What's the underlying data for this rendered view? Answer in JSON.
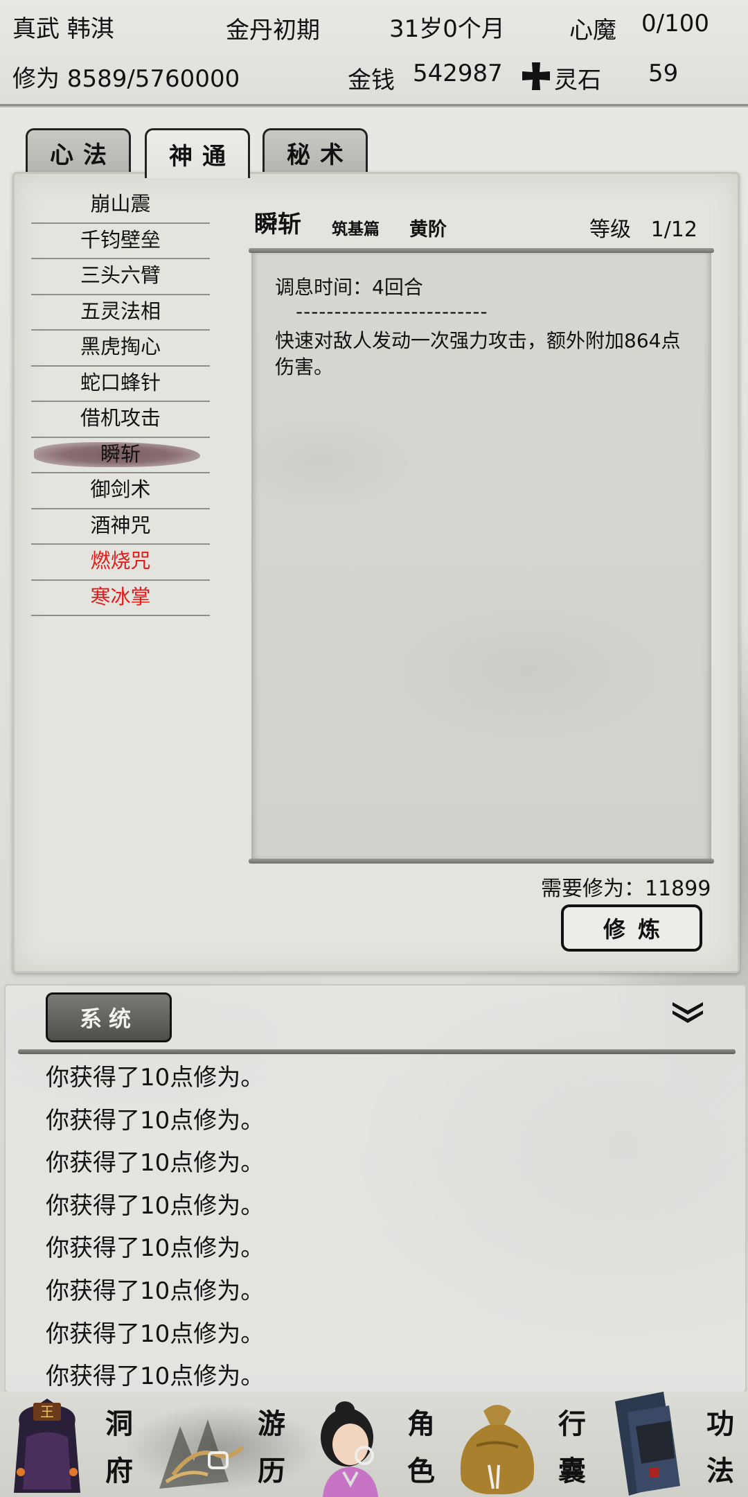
{
  "header": {
    "name": "真武 韩淇",
    "realm": "金丹初期",
    "age": "31岁0个月",
    "demon_label": "心魔",
    "demon_value": "0/100",
    "cultivation": "修为 8589/5760000",
    "money_label": "金钱",
    "money_value": "542987",
    "spirit_stone_label": "灵石",
    "spirit_stone_value": "59"
  },
  "tabs": [
    {
      "label": "心法",
      "active": false
    },
    {
      "label": "神通",
      "active": true
    },
    {
      "label": "秘术",
      "active": false
    }
  ],
  "skills": [
    {
      "name": "崩山震"
    },
    {
      "name": "千钧壁垒"
    },
    {
      "name": "三头六臂"
    },
    {
      "name": "五灵法相"
    },
    {
      "name": "黑虎掏心"
    },
    {
      "name": "蛇口蜂针"
    },
    {
      "name": "借机攻击"
    },
    {
      "name": "瞬斩",
      "selected": true
    },
    {
      "name": "御剑术"
    },
    {
      "name": "酒神咒"
    },
    {
      "name": "燃烧咒",
      "color": "#e31b1b"
    },
    {
      "name": "寒冰掌",
      "color": "#e31b1b"
    }
  ],
  "detail": {
    "name": "瞬斩",
    "chapter": "筑基篇",
    "grade": "黄阶",
    "level_label": "等级",
    "level_value": "1/12",
    "cooldown": "调息时间：4回合",
    "separator": "-------------------------",
    "description": "快速对敌人发动一次强力攻击，额外附加864点伤害。",
    "required": "需要修为：11899",
    "train_button": "修炼"
  },
  "log": {
    "tab_label": "系统",
    "messages": [
      "你获得了10点修为。",
      "你获得了10点修为。",
      "你获得了10点修为。",
      "你获得了10点修为。",
      "你获得了10点修为。",
      "你获得了10点修为。",
      "你获得了10点修为。",
      "你获得了10点修为。"
    ]
  },
  "nav": [
    {
      "label_top": "洞",
      "label_bottom": "府",
      "icon": "cave-icon"
    },
    {
      "label_top": "游",
      "label_bottom": "历",
      "icon": "travel-icon"
    },
    {
      "label_top": "角",
      "label_bottom": "色",
      "icon": "character-icon"
    },
    {
      "label_top": "行",
      "label_bottom": "囊",
      "icon": "bag-icon"
    },
    {
      "label_top": "功",
      "label_bottom": "法",
      "icon": "technique-icon"
    }
  ],
  "colors": {
    "skill_red": "#e31b1b",
    "selected_brush": "#7a5f63",
    "panel_bg": "#e4e4de"
  }
}
